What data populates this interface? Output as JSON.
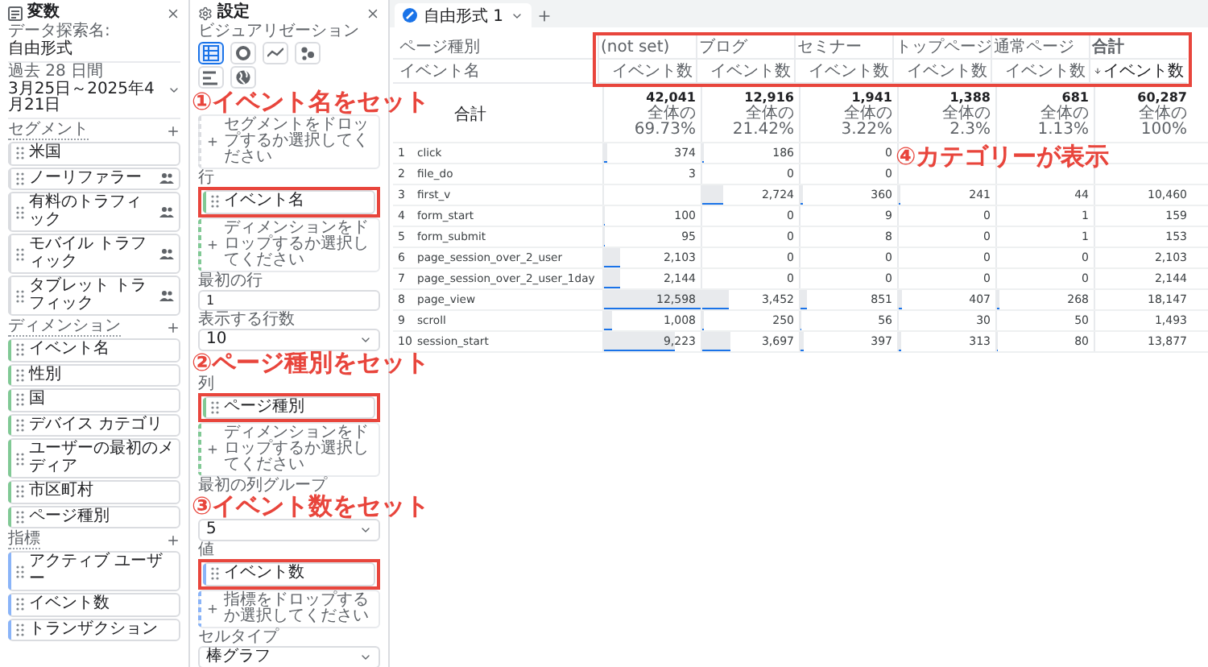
{
  "variables_panel": {
    "title": "変数",
    "exploration_name_label": "データ探索名:",
    "exploration_name": "自由形式",
    "date_range_label": "過去 28 日間",
    "date_range": "3月25日～2025年4月21日",
    "sections": [
      {
        "title": "セグメント",
        "color": "#dadce0",
        "items": [
          {
            "label": "米国",
            "audience": false
          },
          {
            "label": "ノーリファラー",
            "audience": true
          },
          {
            "label": "有料のトラフィック",
            "audience": true
          },
          {
            "label": "モバイル トラフィック",
            "audience": true
          },
          {
            "label": "タブレット トラフィック",
            "audience": true
          }
        ]
      },
      {
        "title": "ディメンション",
        "color": "#81c995",
        "items": [
          {
            "label": "イベント名"
          },
          {
            "label": "性別"
          },
          {
            "label": "国"
          },
          {
            "label": "デバイス カテゴリ"
          },
          {
            "label": "ユーザーの最初のメディア"
          },
          {
            "label": "市区町村"
          },
          {
            "label": "ページ種別"
          }
        ]
      },
      {
        "title": "指標",
        "color": "#8ab4f8",
        "items": [
          {
            "label": "アクティブ ユーザー"
          },
          {
            "label": "イベント数"
          },
          {
            "label": "トランザクション"
          }
        ]
      }
    ]
  },
  "settings_panel": {
    "title": "設定",
    "items": [
      {
        "kind": "heading",
        "text": "ビジュアリゼーション"
      },
      {
        "kind": "visualizations",
        "options": [
          {
            "kind": "table",
            "selected": true
          },
          {
            "kind": "donut",
            "selected": false
          },
          {
            "kind": "line",
            "selected": false
          },
          {
            "kind": "scatter",
            "selected": false
          },
          {
            "kind": "bar",
            "selected": false
          },
          {
            "kind": "map",
            "selected": false
          }
        ]
      },
      {
        "kind": "spacer"
      },
      {
        "kind": "drop",
        "color": "#dadce0",
        "text": "セグメントをドロップするか選択してください"
      },
      {
        "kind": "heading",
        "text": "行"
      },
      {
        "kind": "pill",
        "color": "#81c995",
        "text": "イベント名",
        "highlighted": true
      },
      {
        "kind": "drop",
        "color": "#81c995",
        "text": "ディメンションをドロップするか選択してください"
      },
      {
        "kind": "heading",
        "text": "最初の行"
      },
      {
        "kind": "input",
        "value": "1"
      },
      {
        "kind": "heading",
        "text": "表示する行数"
      },
      {
        "kind": "select",
        "value": "10"
      },
      {
        "kind": "spacer"
      },
      {
        "kind": "heading",
        "text": "列"
      },
      {
        "kind": "pill",
        "color": "#81c995",
        "text": "ページ種別",
        "highlighted": true
      },
      {
        "kind": "drop",
        "color": "#81c995",
        "text": "ディメンションをドロップするか選択してください"
      },
      {
        "kind": "heading",
        "text": "最初の列グループ"
      },
      {
        "kind": "spacer"
      },
      {
        "kind": "select",
        "value": "5"
      },
      {
        "kind": "heading",
        "text": "値"
      },
      {
        "kind": "pill",
        "color": "#8ab4f8",
        "text": "イベント数",
        "highlighted": true
      },
      {
        "kind": "drop",
        "color": "#8ab4f8",
        "text": "指標をドロップするか選択してください"
      },
      {
        "kind": "heading",
        "text": "セルタイプ"
      },
      {
        "kind": "select",
        "value": "棒グラフ"
      }
    ]
  },
  "report": {
    "tab": {
      "label": "自由形式 1"
    },
    "column_dimension": "ページ種別",
    "row_dimension": "イベント名",
    "header_highlighted": true,
    "columns": [
      {
        "kind": "value",
        "label": "(not set)",
        "metric": "イベント数",
        "sorted": false
      },
      {
        "kind": "value",
        "label": "ブログ",
        "metric": "イベント数",
        "sorted": false
      },
      {
        "kind": "value",
        "label": "セミナー",
        "metric": "イベント数",
        "sorted": false
      },
      {
        "kind": "value",
        "label": "トップページ",
        "metric": "イベント数",
        "sorted": false
      },
      {
        "kind": "value",
        "label": "通常ページ",
        "metric": "イベント数",
        "sorted": false
      },
      {
        "kind": "total",
        "label": "合計",
        "metric": "イベント数",
        "sorted": true
      }
    ],
    "totals": {
      "label": "合計",
      "values": [
        {
          "value": "42,041",
          "share": "全体の 69.73%"
        },
        {
          "value": "12,916",
          "share": "全体の 21.42%"
        },
        {
          "value": "1,941",
          "share": "全体の 3.22%"
        },
        {
          "value": "1,388",
          "share": "全体の 2.3%"
        },
        {
          "value": "681",
          "share": "全体の 1.13%"
        },
        {
          "value": "60,287",
          "share": "全体の 100%"
        }
      ]
    },
    "rows": [
      {
        "index": "1",
        "name": "click",
        "cells": [
          {
            "value": "374"
          },
          {
            "value": "186"
          },
          {
            "value": "0"
          },
          {
            "covered": true
          },
          {
            "covered": true
          },
          {
            "covered": true
          }
        ]
      },
      {
        "index": "2",
        "name": "file_do",
        "cells": [
          {
            "value": "3"
          },
          {
            "value": "0"
          },
          {
            "value": "0"
          },
          {
            "covered": true
          },
          {
            "covered": true
          },
          {
            "covered": true
          }
        ]
      },
      {
        "index": "3",
        "name": "first_v",
        "cells": [
          {
            "covered": true
          },
          {
            "value": "2,724"
          },
          {
            "value": "360"
          },
          {
            "value": "241"
          },
          {
            "value": "44"
          },
          {
            "value": "10,460"
          }
        ]
      },
      {
        "index": "4",
        "name": "form_start",
        "cells": [
          {
            "value": "100"
          },
          {
            "value": "0"
          },
          {
            "value": "9"
          },
          {
            "value": "0"
          },
          {
            "value": "1"
          },
          {
            "value": "159"
          }
        ]
      },
      {
        "index": "5",
        "name": "form_submit",
        "cells": [
          {
            "value": "95"
          },
          {
            "value": "0"
          },
          {
            "value": "8"
          },
          {
            "value": "0"
          },
          {
            "value": "1"
          },
          {
            "value": "153"
          }
        ]
      },
      {
        "index": "6",
        "name": "page_session_over_2_user",
        "cells": [
          {
            "value": "2,103"
          },
          {
            "value": "0"
          },
          {
            "value": "0"
          },
          {
            "value": "0"
          },
          {
            "value": "0"
          },
          {
            "value": "2,103"
          }
        ]
      },
      {
        "index": "7",
        "name": "page_session_over_2_user_1day",
        "cells": [
          {
            "value": "2,144"
          },
          {
            "value": "0"
          },
          {
            "value": "0"
          },
          {
            "value": "0"
          },
          {
            "value": "0"
          },
          {
            "value": "2,144"
          }
        ]
      },
      {
        "index": "8",
        "name": "page_view",
        "cells": [
          {
            "value": "12,598"
          },
          {
            "value": "3,452"
          },
          {
            "value": "851"
          },
          {
            "value": "407"
          },
          {
            "value": "268"
          },
          {
            "value": "18,147"
          }
        ]
      },
      {
        "index": "9",
        "name": "scroll",
        "cells": [
          {
            "value": "1,008"
          },
          {
            "value": "250"
          },
          {
            "value": "56"
          },
          {
            "value": "30"
          },
          {
            "value": "50"
          },
          {
            "value": "1,493"
          }
        ]
      },
      {
        "index": "10",
        "name": "session_start",
        "cells": [
          {
            "value": "9,223"
          },
          {
            "value": "3,697"
          },
          {
            "value": "397"
          },
          {
            "value": "313"
          },
          {
            "value": "80"
          },
          {
            "value": "13,877"
          }
        ]
      }
    ]
  },
  "annotations": [
    {
      "text": "①イベント名をセット"
    },
    {
      "text": "②ページ種別をセット"
    },
    {
      "text": "③イベント数をセット"
    },
    {
      "text": "④カテゴリーが表示"
    }
  ]
}
